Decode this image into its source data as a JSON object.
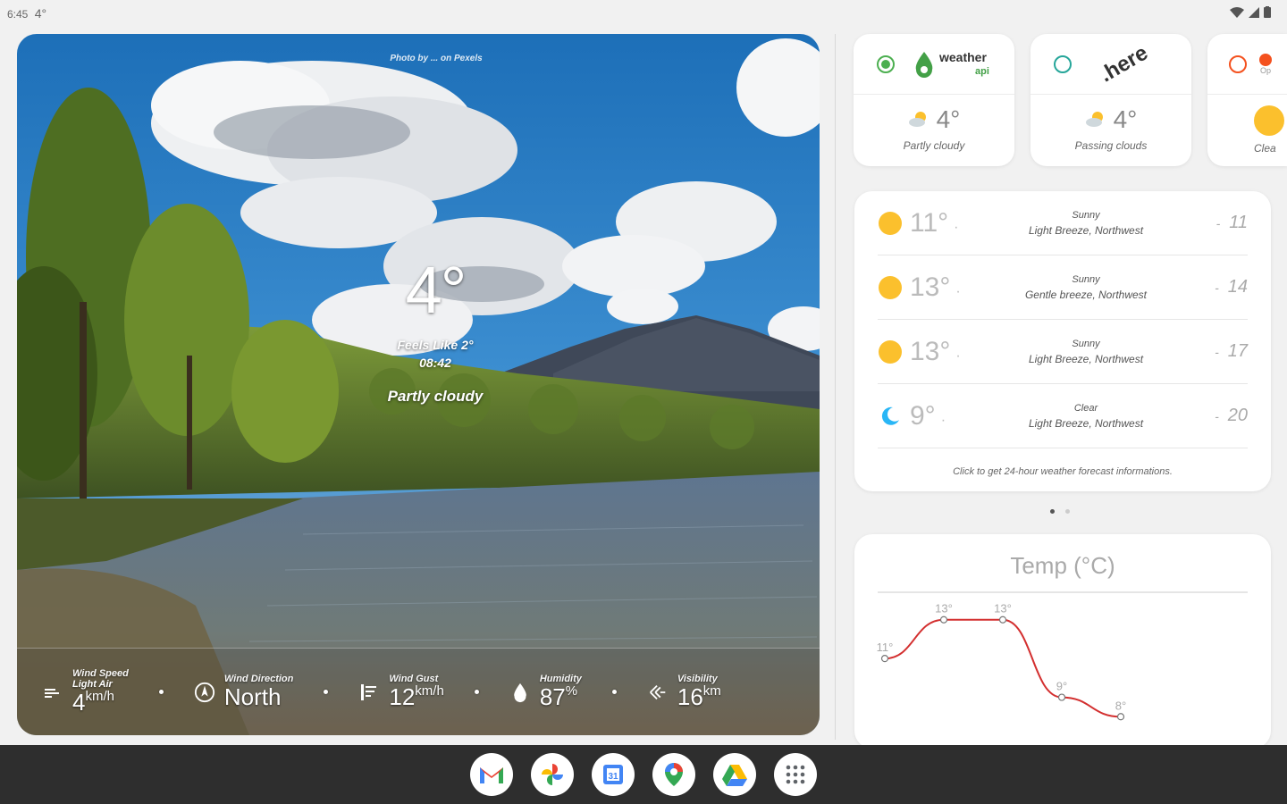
{
  "status": {
    "time": "6:45",
    "temp": "4°"
  },
  "hero": {
    "credit": "Photo by ... on Pexels",
    "temp": "4°",
    "feels_like": "Feels Like 2°",
    "time": "08:42",
    "condition": "Partly cloudy",
    "metrics": [
      {
        "label": "Wind Speed",
        "sub": "Light Air",
        "value": "4",
        "unit": "km/h",
        "icon": "wind-icon"
      },
      {
        "label": "Wind Direction",
        "sub": "",
        "value": "North",
        "unit": "",
        "icon": "compass-icon"
      },
      {
        "label": "Wind Gust",
        "sub": "",
        "value": "12",
        "unit": "km/h",
        "icon": "wind-gust-icon"
      },
      {
        "label": "Humidity",
        "sub": "",
        "value": "87",
        "unit": "%",
        "icon": "humidity-icon"
      },
      {
        "label": "Visibility",
        "sub": "",
        "value": "16",
        "unit": "km",
        "icon": "visibility-icon"
      }
    ]
  },
  "providers": [
    {
      "name": "weather api",
      "logo_main": "weather",
      "logo_sub": "api",
      "temp": "4°",
      "condition": "Partly cloudy",
      "selected": true
    },
    {
      "name": "here",
      "logo_main": ".here",
      "logo_sub": "",
      "temp": "4°",
      "condition": "Passing clouds",
      "selected": false
    },
    {
      "name": "Op",
      "logo_main": "Op",
      "logo_sub": "",
      "temp": "",
      "condition": "Clea",
      "selected": false
    }
  ],
  "forecast": {
    "rows": [
      {
        "temp": "11°",
        "cond": "Sunny",
        "wind": "Light Breeze, Northwest",
        "hour": "11",
        "icon": "sun-icon"
      },
      {
        "temp": "13°",
        "cond": "Sunny",
        "wind": "Gentle breeze, Northwest",
        "hour": "14",
        "icon": "sun-icon"
      },
      {
        "temp": "13°",
        "cond": "Sunny",
        "wind": "Light Breeze, Northwest",
        "hour": "17",
        "icon": "sun-icon"
      },
      {
        "temp": "9°",
        "cond": "Clear",
        "wind": "Light Breeze, Northwest",
        "hour": "20",
        "icon": "moon-icon"
      }
    ],
    "footer": "Click to get 24-hour weather forecast informations."
  },
  "chart_data": {
    "type": "line",
    "title": "Temp (°C)",
    "x": [
      0,
      1,
      2,
      3,
      4
    ],
    "values": [
      11,
      13,
      13,
      9,
      8
    ],
    "labels": [
      "11°",
      "13°",
      "13°",
      "9°",
      "8°"
    ],
    "ylim": [
      7,
      14
    ],
    "line_color": "#d32f2f"
  },
  "colors": {
    "sun": "#fbc02d",
    "accent_green": "#4caf50",
    "moon": "#29b6f6"
  },
  "taskbar": [
    {
      "name": "gmail-icon"
    },
    {
      "name": "photos-icon"
    },
    {
      "name": "calendar-icon"
    },
    {
      "name": "maps-icon"
    },
    {
      "name": "drive-icon"
    },
    {
      "name": "app-drawer-icon"
    }
  ]
}
